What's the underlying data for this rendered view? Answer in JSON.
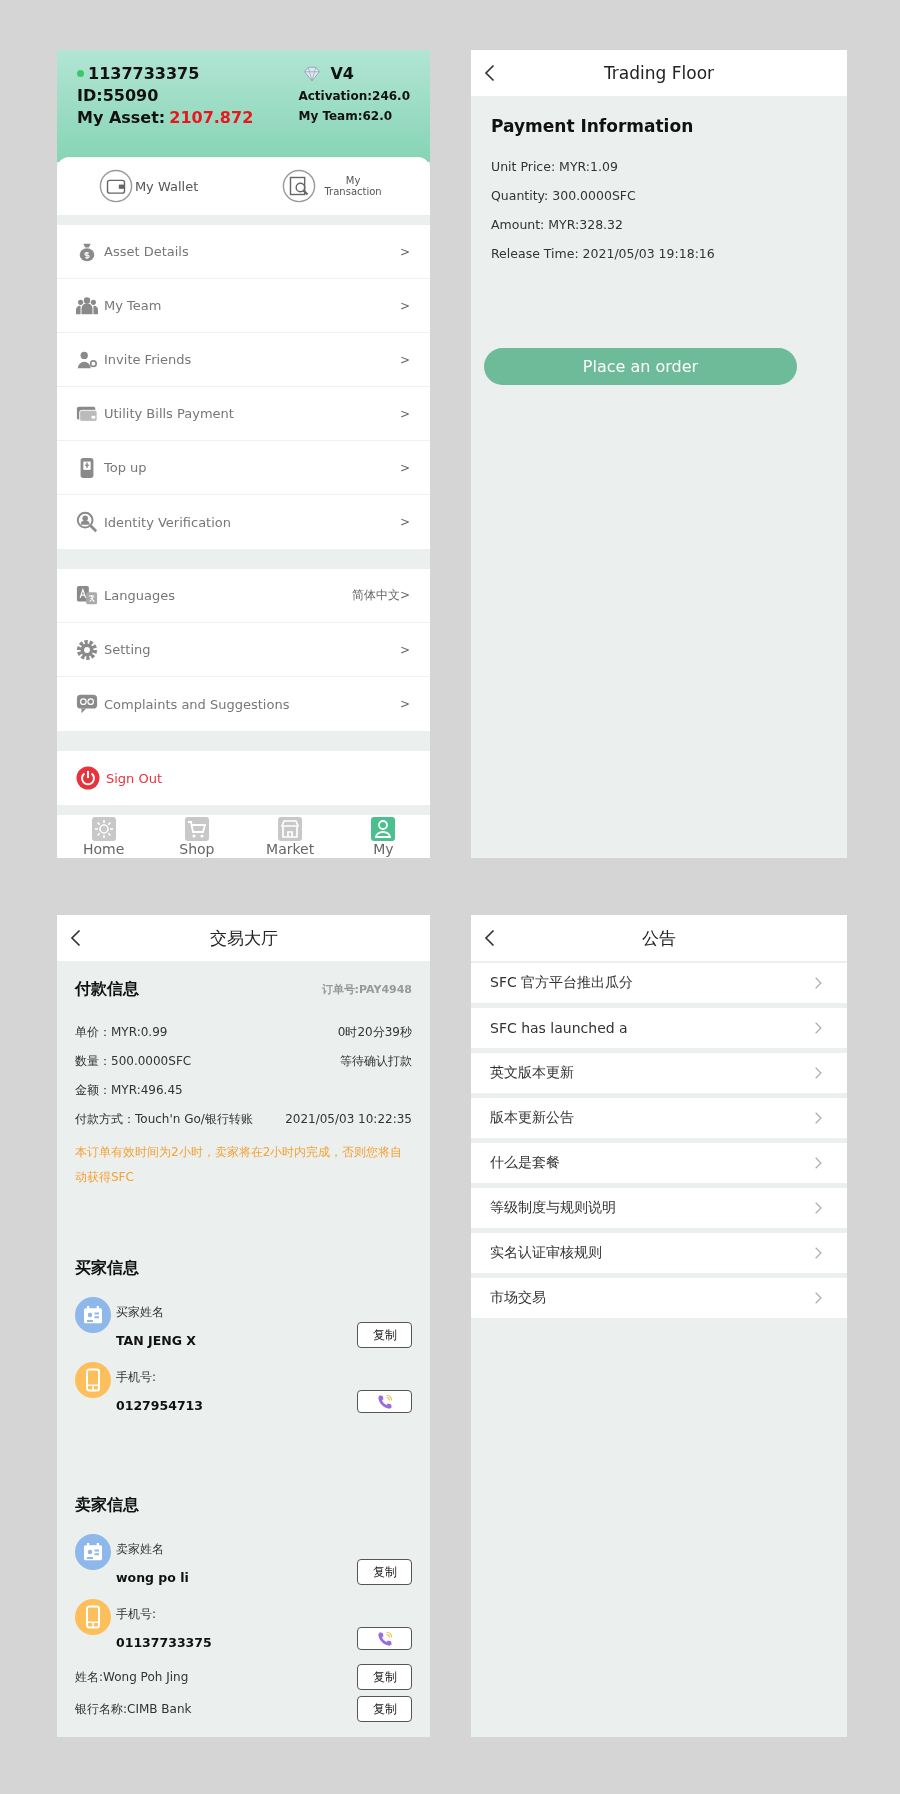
{
  "profile_screen": {
    "header": {
      "online": true,
      "phone": "1137733375",
      "id": "ID:55090",
      "asset_label": "My Asset:",
      "asset_value": "2107.872",
      "level": "V4",
      "activation": "Activation:246.0",
      "team": "My Team:62.0"
    },
    "quick_actions": [
      {
        "kind": "wallet",
        "label": "My Wallet"
      },
      {
        "kind": "transaction",
        "label": "My Transaction"
      }
    ],
    "menu_groups": [
      [
        {
          "kind": "bag",
          "label": "Asset Details",
          "trailing": ">"
        },
        {
          "kind": "team",
          "label": "My Team",
          "trailing": ">"
        },
        {
          "kind": "invite",
          "label": "Invite Friends",
          "trailing": ">"
        },
        {
          "kind": "card",
          "label": "Utility Bills Payment",
          "trailing": ">"
        },
        {
          "kind": "topup",
          "label": "Top up",
          "trailing": ">"
        },
        {
          "kind": "identity",
          "label": "Identity Verification",
          "trailing": ">"
        }
      ],
      [
        {
          "kind": "language",
          "label": "Languages",
          "trailing": "简体中文>"
        },
        {
          "kind": "gear",
          "label": "Setting",
          "trailing": ">"
        },
        {
          "kind": "chat",
          "label": "Complaints and Suggestions",
          "trailing": ">"
        }
      ]
    ],
    "sign_out": "Sign Out",
    "tab_bar": [
      {
        "kind": "home",
        "label": "Home",
        "selected": false
      },
      {
        "kind": "shop",
        "label": "Shop",
        "selected": false
      },
      {
        "kind": "market",
        "label": "Market",
        "selected": false
      },
      {
        "kind": "my",
        "label": "My",
        "selected": true
      }
    ]
  },
  "trading_screen": {
    "title": "Trading Floor",
    "heading": "Payment Information",
    "lines": [
      "Unit Price: MYR:1.09",
      "Quantity: 300.0000SFC",
      "Amount: MYR:328.32",
      "Release Time: 2021/05/03 19:18:16"
    ],
    "button": "Place an order"
  },
  "order_screen": {
    "title": "交易大厅",
    "payment": {
      "heading": "付款信息",
      "order_no": "订单号:PAY4948",
      "rows": [
        {
          "left": "单价：MYR:0.99",
          "right": "0时20分39秒"
        },
        {
          "left": "数量：500.0000SFC",
          "right": "等待确认打款"
        },
        {
          "left": "金额：MYR:496.45"
        },
        {
          "left": "付款方式：Touch'n Go/银行转账",
          "right": "2021/05/03 10:22:35"
        }
      ],
      "notice": "本订单有效时间为2小时，卖家将在2小时内完成，否则您将自动获得SFC"
    },
    "parties": [
      {
        "heading": "买家信息",
        "fields": [
          {
            "kind": "name",
            "label": "买家姓名",
            "value": "TAN JENG X",
            "button": "复制"
          },
          {
            "kind": "phone",
            "label": "手机号:",
            "value": "0127954713"
          }
        ]
      },
      {
        "heading": "卖家信息",
        "fields": [
          {
            "kind": "name",
            "label": "卖家姓名",
            "value": "wong po li",
            "button": "复制"
          },
          {
            "kind": "phone",
            "label": "手机号:",
            "value": "01137733375"
          }
        ]
      }
    ],
    "bank_fields": [
      {
        "text": "姓名:Wong Poh Jing",
        "button": "复制"
      },
      {
        "text": "银行名称:CIMB Bank",
        "button": "复制"
      }
    ]
  },
  "notice_screen": {
    "title": "公告",
    "items": [
      "SFC 官方平台推出瓜分",
      "SFC has launched a",
      "英文版本更新",
      "版本更新公告",
      "什么是套餐",
      "等级制度与规则说明",
      "实名认证审核规则",
      "市场交易"
    ]
  }
}
